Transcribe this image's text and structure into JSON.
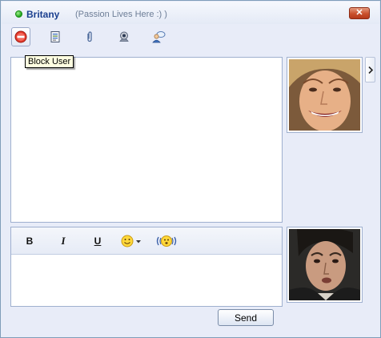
{
  "window": {
    "contact_name": "Britany",
    "status_message": "(Passion Lives Here :) )",
    "status_color": "#2db52a",
    "close_symbol": "✕"
  },
  "toolbar": {
    "items": [
      {
        "name": "block-user",
        "icon": "block-icon",
        "tooltip": "Block User"
      },
      {
        "name": "contact-info",
        "icon": "contact-card-icon"
      },
      {
        "name": "send-file",
        "icon": "paperclip-icon"
      },
      {
        "name": "webcam",
        "icon": "webcam-icon"
      },
      {
        "name": "contact-options",
        "icon": "person-bubble-icon"
      }
    ],
    "tooltip_text": "Block User"
  },
  "avatars": {
    "contact": "contact-avatar-photo",
    "self": "self-avatar-photo"
  },
  "formatting": {
    "bold": "B",
    "italic": "I",
    "underline": "U",
    "emoticon_icon": "smiley-icon",
    "nudge_icon": "nudge-icon"
  },
  "compose": {
    "value": "",
    "send_label": "Send"
  },
  "colors": {
    "accent": "#1a3f8f",
    "window_bg": "#e8ecf8",
    "border": "#9fb0cf"
  }
}
